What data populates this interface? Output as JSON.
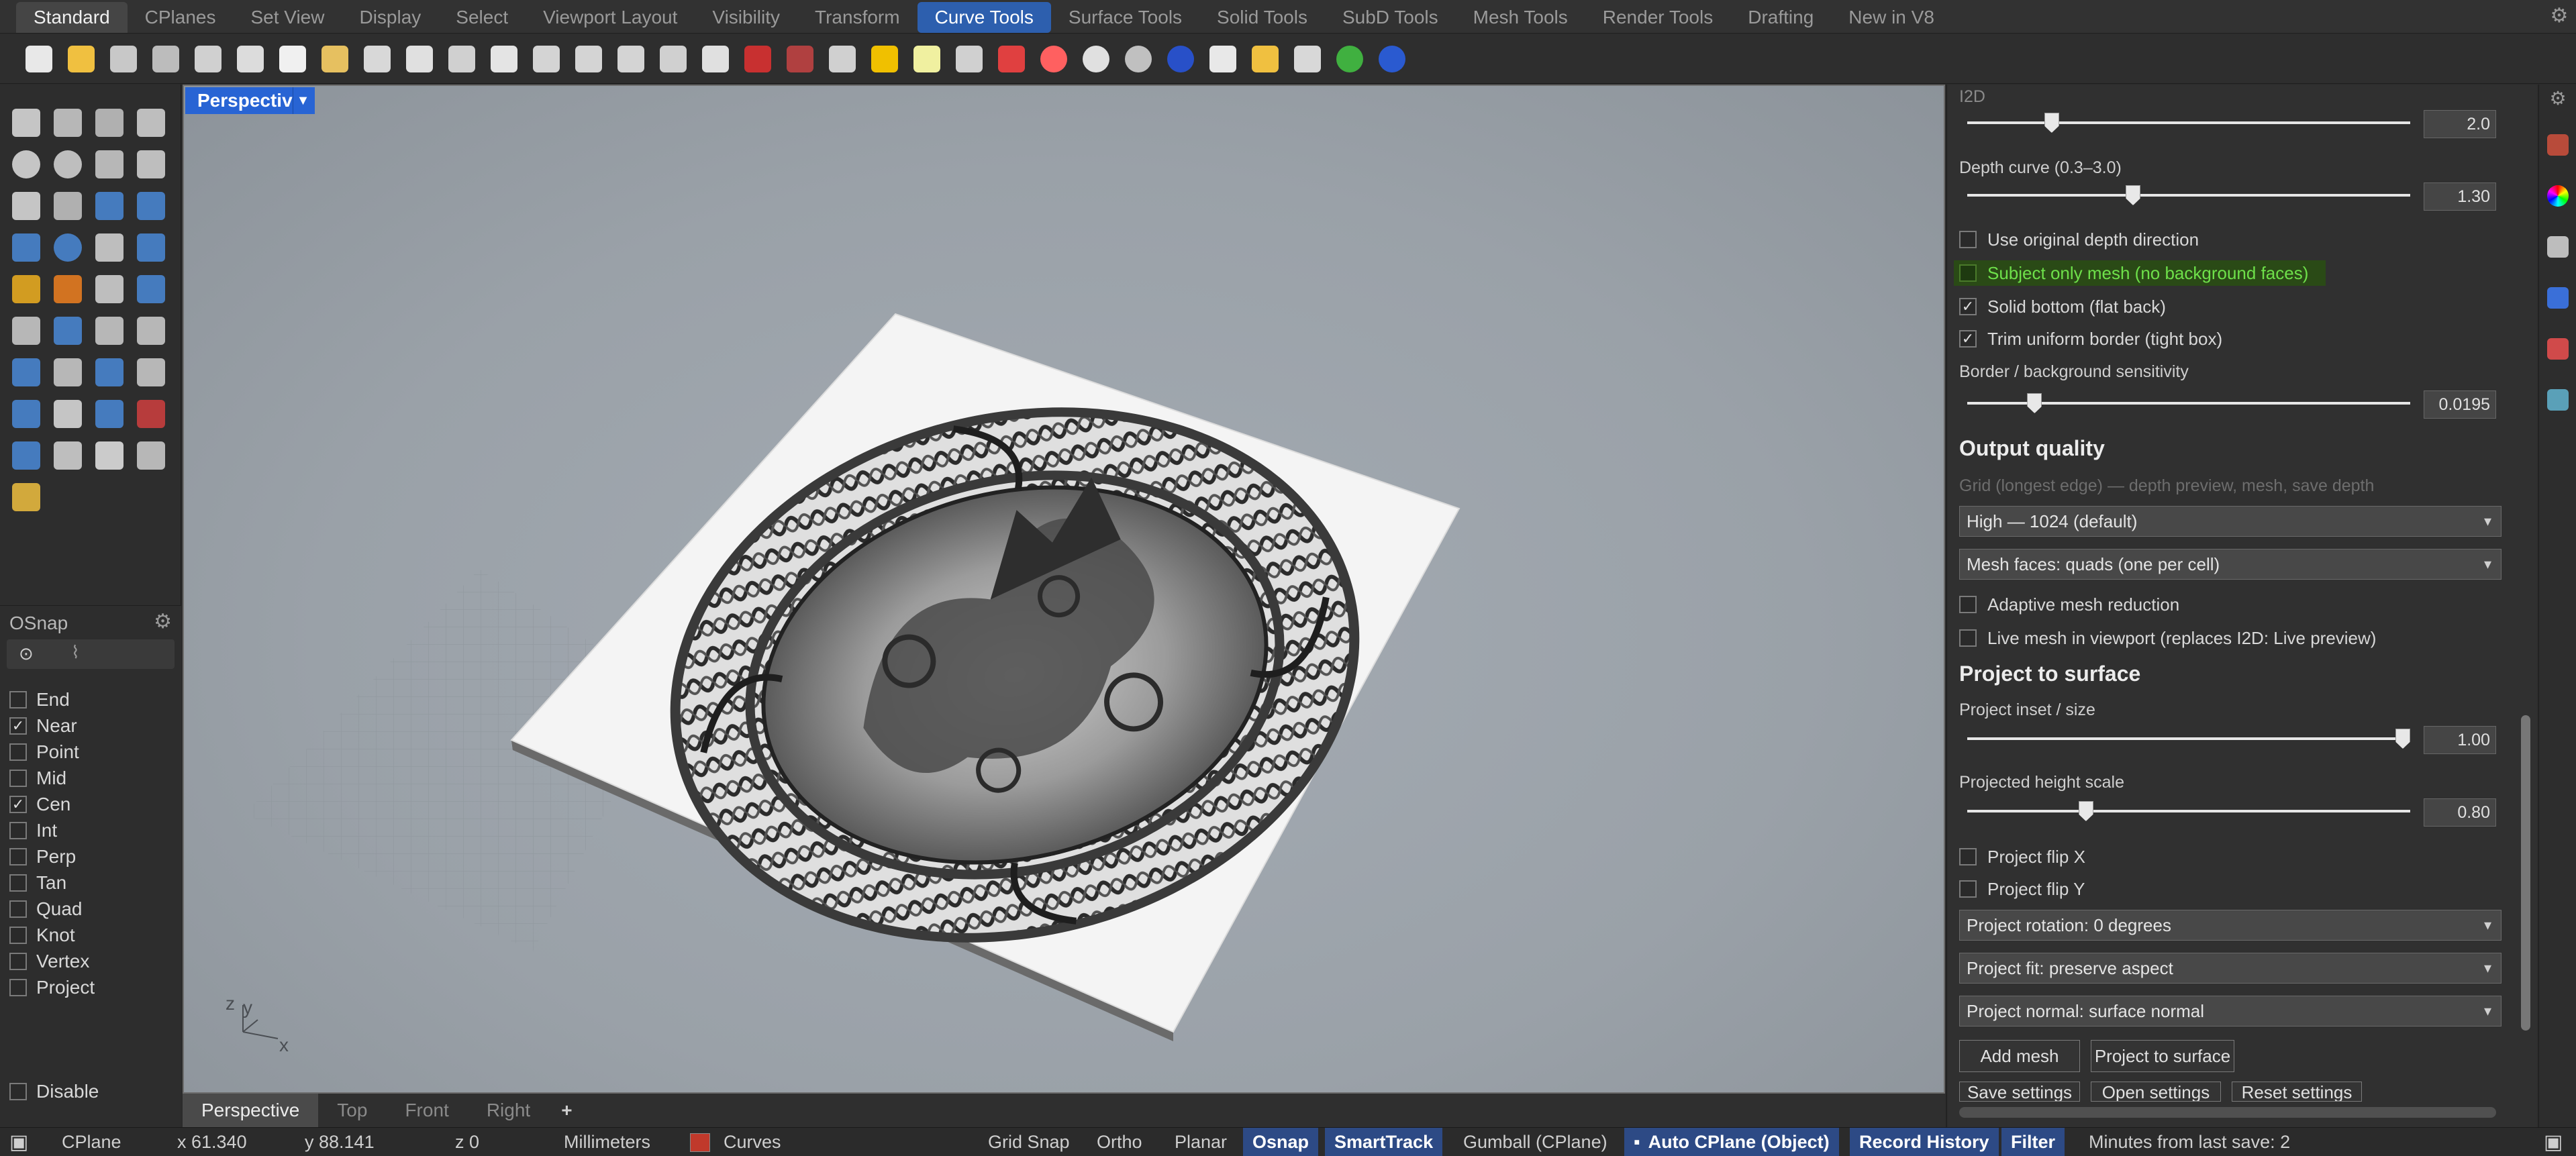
{
  "tabs": [
    "Standard",
    "CPlanes",
    "Set View",
    "Display",
    "Select",
    "Viewport Layout",
    "Visibility",
    "Transform",
    "Curve Tools",
    "Surface Tools",
    "Solid Tools",
    "SubD Tools",
    "Mesh Tools",
    "Render Tools",
    "Drafting",
    "New in V8"
  ],
  "toolbar_icons": [
    "new-file-icon",
    "open-file-icon",
    "save-icon",
    "print-icon",
    "import-icon",
    "cut-icon",
    "copy-icon",
    "paste-icon",
    "undo-icon",
    "pan-hand-icon",
    "rotate-view-icon",
    "zoom-icon",
    "zoom-extents-icon",
    "zoom-window-icon",
    "zoom-selected-icon",
    "undo-view-icon",
    "four-viewports-icon",
    "car-icon",
    "grid-icon",
    "circle-point-icon",
    "light-icon",
    "bulb-icon",
    "lock-icon",
    "layer-icon",
    "color-wheel-icon",
    "globe-icon",
    "mesh-sphere-icon",
    "render-sphere-icon",
    "material-icon",
    "gear-cog-icon",
    "dimension-icon",
    "green-sphere-icon",
    "help-icon"
  ],
  "osnap": {
    "title": "OSnap",
    "items": [
      {
        "label": "End",
        "checked": false
      },
      {
        "label": "Near",
        "checked": true
      },
      {
        "label": "Point",
        "checked": false
      },
      {
        "label": "Mid",
        "checked": false
      },
      {
        "label": "Cen",
        "checked": true
      },
      {
        "label": "Int",
        "checked": false
      },
      {
        "label": "Perp",
        "checked": false
      },
      {
        "label": "Tan",
        "checked": false
      },
      {
        "label": "Quad",
        "checked": false
      },
      {
        "label": "Knot",
        "checked": false
      },
      {
        "label": "Vertex",
        "checked": false
      },
      {
        "label": "Project",
        "checked": false
      }
    ],
    "disable": "Disable"
  },
  "viewport": {
    "label": "Perspective",
    "axis_x": "x",
    "axis_y": "y",
    "axis_z": "z"
  },
  "view_tabs": [
    "Perspective",
    "Top",
    "Front",
    "Right"
  ],
  "panel": {
    "i2d_label": "I2D",
    "i2d_value": "2.0",
    "i2d_slider": 0.18,
    "depth_curve_label": "Depth curve (0.3–3.0)",
    "depth_curve_value": "1.30",
    "depth_curve_slider": 0.37,
    "use_original": "Use original depth direction",
    "subject_only": "Subject only mesh (no background faces)",
    "solid_bottom": "Solid bottom (flat back)",
    "trim_border": "Trim uniform border (tight box)",
    "border_label": "Border / background sensitivity",
    "border_value": "0.0195",
    "border_slider": 0.14,
    "output_quality": "Output quality",
    "grid_hint": "Grid (longest edge) — depth preview, mesh, save depth",
    "grid_select": "High — 1024 (default)",
    "mesh_faces_select": "Mesh faces: quads (one per cell)",
    "adaptive": "Adaptive mesh reduction",
    "live_mesh": "Live mesh in viewport (replaces I2D: Live preview)",
    "project_section": "Project to surface",
    "inset_label": "Project inset / size",
    "inset_value": "1.00",
    "inset_slider": 1.0,
    "height_label": "Projected height scale",
    "height_value": "0.80",
    "height_slider": 0.26,
    "flip_x": "Project flip X",
    "flip_y": "Project flip Y",
    "rotation_select": "Project rotation: 0 degrees",
    "fit_select": "Project fit: preserve aspect",
    "normal_select": "Project normal: surface normal",
    "add_mesh": "Add mesh",
    "project_to_surface": "Project to surface",
    "save_settings": "Save settings",
    "open_settings": "Open settings",
    "reset_settings": "Reset settings"
  },
  "status": {
    "cplane": "CPlane",
    "x": "x 61.340",
    "y": "y 88.141",
    "z": "z 0",
    "units": "Millimeters",
    "layer": "Curves",
    "layer_color": "#c0392b",
    "grid_snap": "Grid Snap",
    "ortho": "Ortho",
    "planar": "Planar",
    "osnap": "Osnap",
    "smarttrack": "SmartTrack",
    "gumball": "Gumball (CPlane)",
    "auto_cplane": "Auto CPlane (Object)",
    "record_history": "Record History",
    "filter": "Filter",
    "minutes": "Minutes from last save: 2"
  }
}
